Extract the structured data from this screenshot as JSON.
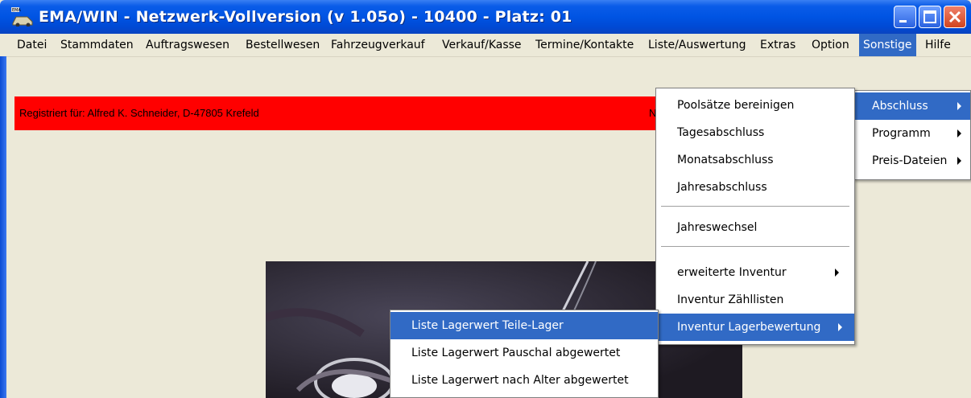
{
  "window": {
    "title": "EMA/WIN - Netzwerk-Vollversion (v  1.05o) - 10400 - Platz: 01"
  },
  "menubar": {
    "items": [
      "Datei",
      "Stammdaten",
      "Auftragswesen",
      "Bestellwesen",
      "Fahrzeugverkauf",
      "Verkauf/Kasse",
      "Termine/Kontakte",
      "Liste/Auswertung",
      "Extras",
      "Option",
      "Sonstige",
      "Hilfe"
    ],
    "active": "Sonstige"
  },
  "registration": {
    "text": "Registriert für: Alfred K. Schneider, D-47805 Krefeld",
    "partial": "N"
  },
  "sonstige_menu": {
    "items": [
      "Abschluss",
      "Programm",
      "Preis-Dateien"
    ],
    "active": "Abschluss"
  },
  "abschluss_menu": {
    "group1": [
      "Poolsätze bereinigen",
      "Tagesabschluss",
      "Monatsabschluss",
      "Jahresabschluss"
    ],
    "group2": [
      "Jahreswechsel"
    ],
    "group3": [
      "erweiterte Inventur",
      "Inventur Zähllisten",
      "Inventur Lagerbewertung"
    ],
    "active": "Inventur Lagerbewertung"
  },
  "lagerbewertung_menu": {
    "items": [
      "Liste Lagerwert Teile-Lager",
      "Liste Lagerwert Pauschal  abgewertet",
      "Liste Lagerwert nach Alter abgewertet"
    ],
    "active": "Liste Lagerwert Teile-Lager"
  },
  "icons": {
    "app": "ema-app-icon",
    "minimize": "minimize-icon",
    "maximize": "maximize-icon",
    "close": "close-icon",
    "submenu": "submenu-arrow-icon"
  },
  "colors": {
    "titlebar": "#0054e3",
    "highlight": "#316ac5",
    "registration_bar": "#ff0000",
    "background": "#ece9d8"
  }
}
